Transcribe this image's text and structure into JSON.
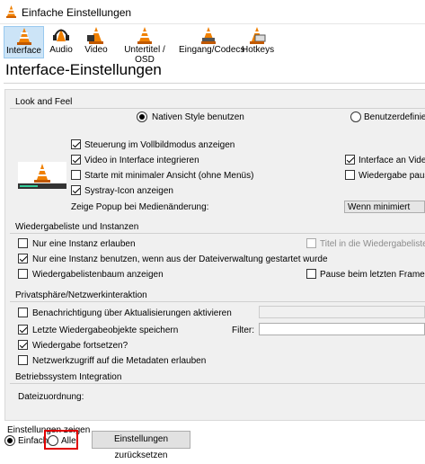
{
  "window": {
    "title": "Einfache Einstellungen"
  },
  "toolbar": {
    "items": [
      {
        "label": "Interface",
        "icon": "interface-cone-icon",
        "active": true
      },
      {
        "label": "Audio",
        "icon": "headphones-cone-icon",
        "active": false
      },
      {
        "label": "Video",
        "icon": "video-cone-icon",
        "active": false
      },
      {
        "label": "Untertitel / OSD",
        "icon": "subtitles-cone-icon",
        "active": false
      },
      {
        "label": "Eingang/Codecs",
        "icon": "codecs-cone-icon",
        "active": false
      },
      {
        "label": "Hotkeys",
        "icon": "hotkeys-cone-icon",
        "active": false
      }
    ]
  },
  "page": {
    "title": "Interface-Einstellungen"
  },
  "look_feel": {
    "section": "Look and Feel",
    "native_style": "Nativen Style benutzen",
    "custom_style": "Benutzerdefiniert",
    "fullscreen_controls": "Steuerung im Vollbildmodus anzeigen",
    "video_integrate": "Video in Interface integrieren",
    "minimal_view": "Starte mit minimaler Ansicht (ohne Menüs)",
    "systray": "Systray-Icon anzeigen",
    "popup_label": "Zeige Popup bei Medienänderung:",
    "popup_value": "Wenn minimiert",
    "interface_video": "Interface an Videog",
    "pause_playback": "Wiedergabe pausie"
  },
  "playlist": {
    "section": "Wiedergabeliste und Instanzen",
    "one_instance": "Nur eine Instanz erlauben",
    "one_instance_file": "Nur eine Instanz benutzen, wenn aus der Dateiverwaltung gestartet wurde",
    "tree": "Wiedergabelistenbaum anzeigen",
    "title_playlist": "Titel in die Wiedergabeliste ein",
    "pause_last": "Pause beim letzten Frame eine"
  },
  "privacy": {
    "section": "Privatsphäre/Netzwerkinteraktion",
    "update_notify": "Benachrichtigung über Aktualisierungen aktivieren",
    "save_recent": "Letzte Wiedergabeobjekte speichern",
    "filter_label": "Filter:",
    "resume": "Wiedergabe fortsetzen?",
    "metadata": "Netzwerkzugriff auf die Metadaten erlauben"
  },
  "os": {
    "section": "Betriebssystem Integration",
    "file_assoc": "Dateizuordnung:"
  },
  "bottom": {
    "show_settings": "Einstellungen zeigen",
    "simple": "Einfach",
    "all": "Alle",
    "reset": "Einstellungen zurücksetzen"
  },
  "colors": {
    "accent": "#0078d7",
    "highlight": "#e00000",
    "cone": "#f08000"
  }
}
